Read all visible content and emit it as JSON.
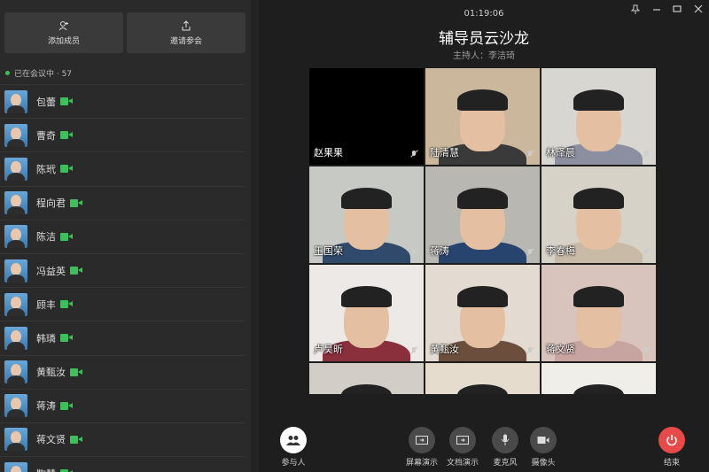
{
  "sidebar": {
    "add_member_label": "添加成员",
    "invite_label": "邀请参会",
    "status_text": "已在会议中 · 57",
    "members": [
      {
        "name": "包蕾"
      },
      {
        "name": "曹奇"
      },
      {
        "name": "陈玳"
      },
      {
        "name": "程向君"
      },
      {
        "name": "陈洁"
      },
      {
        "name": "冯益英"
      },
      {
        "name": "顾丰"
      },
      {
        "name": "韩璘"
      },
      {
        "name": "黄甄汝"
      },
      {
        "name": "蒋涛"
      },
      {
        "name": "蒋文贤"
      },
      {
        "name": "鞠慧"
      }
    ]
  },
  "meeting": {
    "timer": "01:19:06",
    "title": "辅导员云沙龙",
    "host": "主持人：李洁琦"
  },
  "videos": [
    {
      "name": "赵果果",
      "bg": "#000000",
      "shirt": "#000000"
    },
    {
      "name": "陆清慧",
      "bg": "#cbb89c",
      "shirt": "#3a3a3a"
    },
    {
      "name": "林泽晨",
      "bg": "#d8d6d0",
      "shirt": "#8b8fa0"
    },
    {
      "name": "王国荣",
      "bg": "#c7c9c4",
      "shirt": "#2f4a6a"
    },
    {
      "name": "蒋涛",
      "bg": "#b9b7b2",
      "shirt": "#27446e"
    },
    {
      "name": "李春梅",
      "bg": "#d7d2c8",
      "shirt": "#c9b9a7"
    },
    {
      "name": "卢昊昕",
      "bg": "#ece9e6",
      "shirt": "#8a2f3c"
    },
    {
      "name": "黄甄汝",
      "bg": "#e3dbd2",
      "shirt": "#6b4f3c"
    },
    {
      "name": "蒋文贤",
      "bg": "#d8c4bc",
      "shirt": "#c7a4a0"
    },
    {
      "name": "",
      "bg": "#d2cdc6",
      "shirt": "#555555"
    },
    {
      "name": "",
      "bg": "#e6dccd",
      "shirt": "#777777"
    },
    {
      "name": "",
      "bg": "#f0eee9",
      "shirt": "#444444"
    }
  ],
  "toolbar": {
    "participants_label": "参与人",
    "screen_share_label": "屏幕演示",
    "doc_share_label": "文档演示",
    "mic_label": "麦克风",
    "camera_label": "摄像头",
    "end_label": "结束"
  },
  "colors": {
    "accent_green": "#3fbf5c",
    "end_red": "#e84949"
  }
}
